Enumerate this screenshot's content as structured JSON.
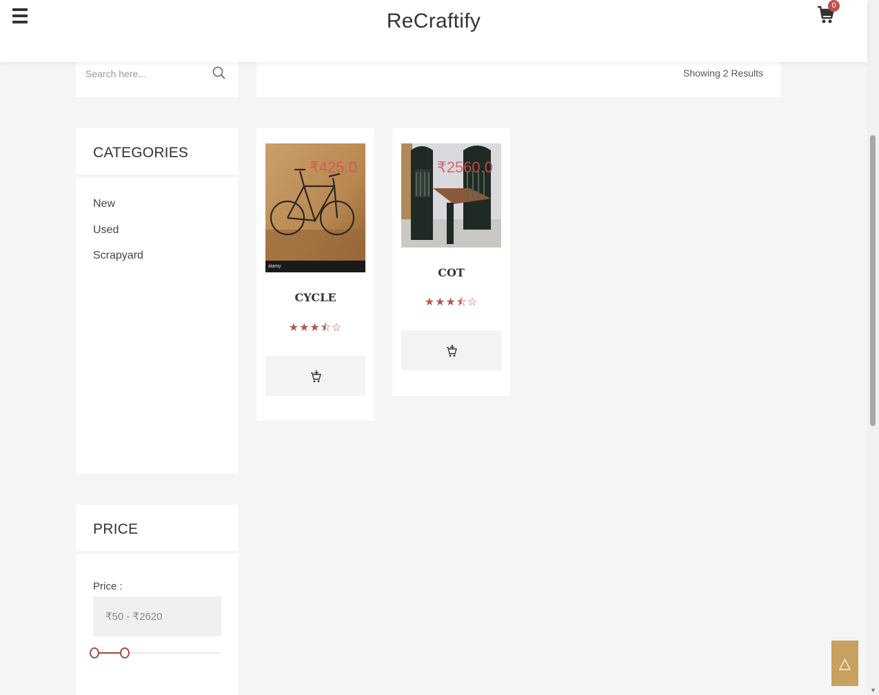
{
  "header": {
    "brand": "ReCraftify",
    "cart_count": "0"
  },
  "search": {
    "placeholder": "Search here..."
  },
  "results": {
    "text": "Showing 2 Results"
  },
  "categories": {
    "title": "CATEGORIES",
    "items": [
      "New",
      "Used",
      "Scrapyard"
    ]
  },
  "price_filter": {
    "title": "PRICE",
    "label": "Price :",
    "range": "₹50 - ₹2620",
    "min_value": 50,
    "max_value": 2620,
    "selected_low_fraction": 0.0,
    "selected_high_fraction": 0.25
  },
  "products": [
    {
      "name": "CYCLE",
      "price": "₹425.0",
      "rating": 3.5,
      "stars": "★★★⯪☆",
      "image": "bicycle-photo"
    },
    {
      "name": "COT",
      "price": "₹2560.0",
      "rating": 3.5,
      "stars": "★★★⯪☆",
      "image": "cot-photo"
    }
  ],
  "colors": {
    "accent": "#b5564e",
    "price": "#d9534f",
    "scroll_top_button": "#c8a060",
    "background": "#f5f5f5"
  },
  "scroll_top": {
    "icon": "triangle-up-icon",
    "glyph": "△"
  }
}
